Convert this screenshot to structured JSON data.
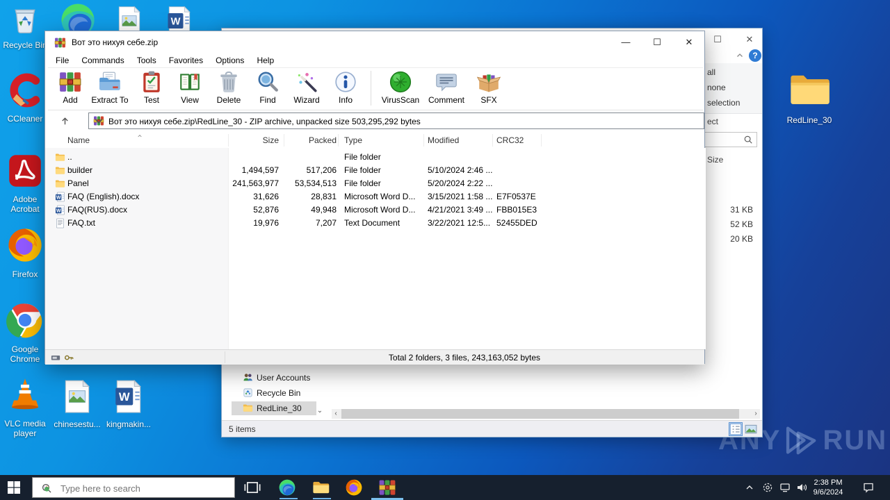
{
  "desktop": {
    "icons": [
      {
        "label": "Recycle Bin",
        "kind": "recycle-bin"
      },
      {
        "label": "CCleaner",
        "kind": "ccleaner"
      },
      {
        "label": "Adobe Acrobat",
        "kind": "acrobat"
      },
      {
        "label": "Firefox",
        "kind": "firefox"
      },
      {
        "label": "Google Chrome",
        "kind": "chrome"
      },
      {
        "label": "VLC media player",
        "kind": "vlc"
      },
      {
        "label": "chinesestu...",
        "kind": "image-file"
      },
      {
        "label": "kingmakin...",
        "kind": "word-file"
      },
      {
        "label": "",
        "kind": "edge"
      },
      {
        "label": "",
        "kind": "image-file"
      },
      {
        "label": "",
        "kind": "word-file"
      },
      {
        "label": "RedLine_30",
        "kind": "folder-large"
      }
    ],
    "watermark": {
      "any": "ANY",
      "run": "RUN"
    }
  },
  "winrar": {
    "title": "Вот это нихуя себе.zip",
    "window_controls": {
      "minimize": "—",
      "maximize": "☐",
      "close": "✕"
    },
    "menu": [
      "File",
      "Commands",
      "Tools",
      "Favorites",
      "Options",
      "Help"
    ],
    "toolbar": [
      {
        "label": "Add",
        "icon": "tool-add"
      },
      {
        "label": "Extract To",
        "icon": "tool-extract"
      },
      {
        "label": "Test",
        "icon": "tool-test"
      },
      {
        "label": "View",
        "icon": "tool-view"
      },
      {
        "label": "Delete",
        "icon": "tool-delete"
      },
      {
        "label": "Find",
        "icon": "tool-find"
      },
      {
        "label": "Wizard",
        "icon": "tool-wizard"
      },
      {
        "label": "Info",
        "icon": "tool-info"
      },
      {
        "label": "VirusScan",
        "icon": "tool-virusscan",
        "sep_before": true
      },
      {
        "label": "Comment",
        "icon": "tool-comment"
      },
      {
        "label": "SFX",
        "icon": "tool-sfx"
      }
    ],
    "address": "Вот это нихуя себе.zip\\RedLine_30 - ZIP archive, unpacked size 503,295,292 bytes",
    "columns": [
      "Name",
      "Size",
      "Packed",
      "Type",
      "Modified",
      "CRC32"
    ],
    "rows": [
      {
        "name": "..",
        "icon": "folder",
        "size": "",
        "packed": "",
        "type": "File folder",
        "modified": "",
        "crc": ""
      },
      {
        "name": "builder",
        "icon": "folder",
        "size": "1,494,597",
        "packed": "517,206",
        "type": "File folder",
        "modified": "5/10/2024 2:46 ...",
        "crc": ""
      },
      {
        "name": "Panel",
        "icon": "folder",
        "size": "241,563,977",
        "packed": "53,534,513",
        "type": "File folder",
        "modified": "5/20/2024 2:22 ...",
        "crc": ""
      },
      {
        "name": "FAQ (English).docx",
        "icon": "word-doc",
        "size": "31,626",
        "packed": "28,831",
        "type": "Microsoft Word D...",
        "modified": "3/15/2021 1:58 ...",
        "crc": "E7F0537E"
      },
      {
        "name": "FAQ(RUS).docx",
        "icon": "word-doc",
        "size": "52,876",
        "packed": "49,948",
        "type": "Microsoft Word D...",
        "modified": "4/21/2021 3:49 ...",
        "crc": "FBB015E3"
      },
      {
        "name": "FAQ.txt",
        "icon": "text-doc",
        "size": "19,976",
        "packed": "7,207",
        "type": "Text Document",
        "modified": "3/22/2021 12:5...",
        "crc": "52455DED"
      }
    ],
    "status_total": "Total 2 folders, 3 files, 243,163,052 bytes"
  },
  "explorer": {
    "window_controls": {
      "maximize": "☐",
      "close": "✕"
    },
    "help_label": "?",
    "ribbon_fragments": [
      "all",
      "none",
      "selection"
    ],
    "address_fragment": "ect",
    "size_header": "Size",
    "file_sizes": [
      "31 KB",
      "52 KB",
      "20 KB"
    ],
    "nav_items": [
      {
        "label": "User Accounts",
        "icon": "users",
        "selected": false
      },
      {
        "label": "Recycle Bin",
        "icon": "recycle-small",
        "selected": false
      },
      {
        "label": "RedLine_30",
        "icon": "folder-small",
        "selected": true
      }
    ],
    "status": "5 items"
  },
  "taskbar": {
    "search_placeholder": "Type here to search",
    "time": "2:38 PM",
    "date": "9/6/2024"
  }
}
